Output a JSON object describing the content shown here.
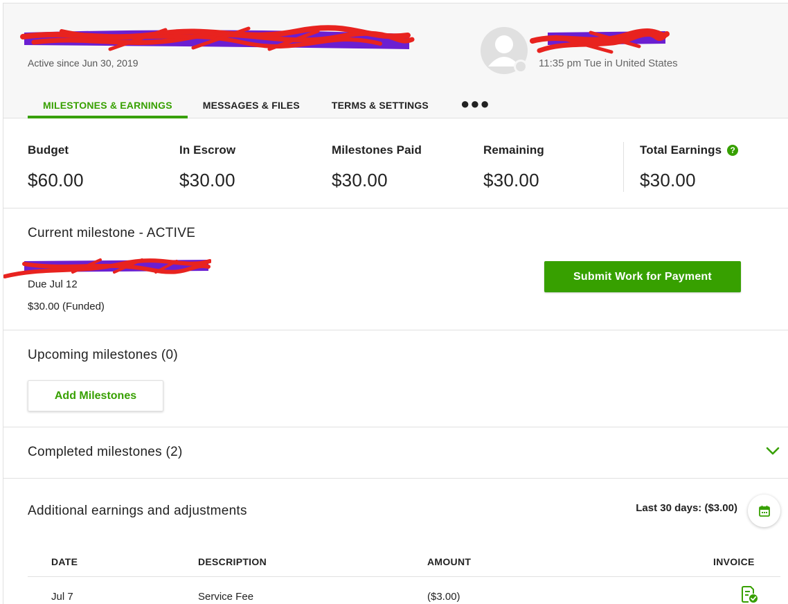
{
  "header": {
    "active_since": "Active since Jun 30, 2019",
    "local_time": "11:35 pm Tue in United States"
  },
  "tabs": [
    {
      "label": "MILESTONES & EARNINGS",
      "active": true
    },
    {
      "label": "MESSAGES & FILES"
    },
    {
      "label": "TERMS & SETTINGS"
    },
    {
      "label": "●●●"
    }
  ],
  "stats": [
    {
      "label": "Budget",
      "value": "$60.00"
    },
    {
      "label": "In Escrow",
      "value": "$30.00"
    },
    {
      "label": "Milestones Paid",
      "value": "$30.00"
    },
    {
      "label": "Remaining",
      "value": "$30.00"
    },
    {
      "label": "Total Earnings",
      "value": "$30.00",
      "help_icon": "?"
    }
  ],
  "current_milestone": {
    "title": "Current milestone - ACTIVE",
    "due": "Due Jul 12",
    "amount": "$30.00 (Funded)",
    "submit_label": "Submit Work for Payment"
  },
  "upcoming": {
    "title": "Upcoming milestones (0)",
    "add_label": "Add Milestones"
  },
  "completed": {
    "title": "Completed milestones (2)"
  },
  "additional": {
    "title": "Additional earnings and adjustments",
    "last_30_days": "Last 30 days: ($3.00)",
    "columns": [
      "DATE",
      "DESCRIPTION",
      "AMOUNT",
      "INVOICE"
    ],
    "rows": [
      {
        "date": "Jul 7",
        "description": "Service Fee",
        "amount": "($3.00)",
        "invoice_icon": "invoice-check-icon"
      }
    ]
  },
  "colors": {
    "accent": "#37a000",
    "redaction_red": "#e8231f",
    "redaction_purple": "#6b1fd1"
  }
}
